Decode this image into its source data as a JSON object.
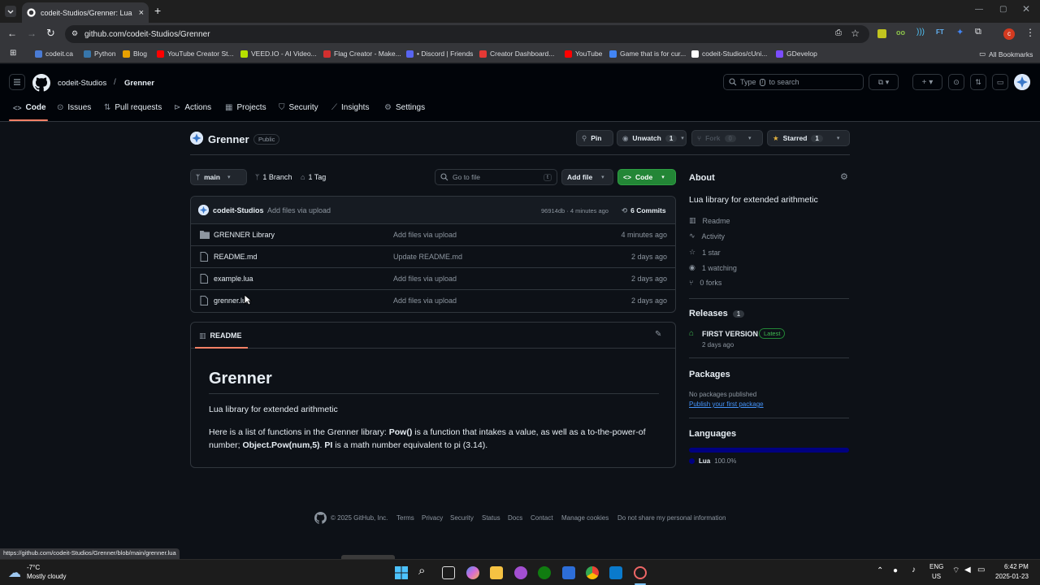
{
  "browser": {
    "tab_title": "codeit-Studios/Grenner: Lua lib…",
    "url": "github.com/codeit-Studios/Grenner",
    "bookmarks": [
      {
        "label": "codeit.ca",
        "color": "#4a7bd4"
      },
      {
        "label": "Python",
        "color": "#3776ab"
      },
      {
        "label": "Blog",
        "color": "#e8a100"
      },
      {
        "label": "YouTube Creator St...",
        "color": "#ff0000"
      },
      {
        "label": "VEED.IO - AI Video...",
        "color": "#b7e000"
      },
      {
        "label": "Flag Creator - Make...",
        "color": "#d32f2f"
      },
      {
        "label": "• Discord | Friends",
        "color": "#5865f2"
      },
      {
        "label": "Creator Dashboard...",
        "color": "#e53935"
      },
      {
        "label": "YouTube",
        "color": "#ff0000"
      },
      {
        "label": "Game that is for cur...",
        "color": "#4285f4"
      },
      {
        "label": "codeit-Studios/cUni...",
        "color": "#ffffff"
      },
      {
        "label": "GDevelop",
        "color": "#7b4dff"
      }
    ],
    "all_bookmarks": "All Bookmarks",
    "status_url": "https://github.com/codeit-Studios/Grenner/blob/main/grenner.lua"
  },
  "header": {
    "owner": "codeit-Studios",
    "slash": "/",
    "repo": "Grenner",
    "search_pre": "Type",
    "search_key": "/",
    "search_post": "to search"
  },
  "nav": {
    "code": "Code",
    "issues": "Issues",
    "pulls": "Pull requests",
    "actions": "Actions",
    "projects": "Projects",
    "security": "Security",
    "insights": "Insights",
    "settings": "Settings"
  },
  "repo": {
    "name": "Grenner",
    "visibility": "Public",
    "pin": "Pin",
    "unwatch": "Unwatch",
    "watch_count": "1",
    "fork": "Fork",
    "fork_count": "0",
    "starred": "Starred",
    "star_count": "1",
    "branch": "main",
    "branches": "1 Branch",
    "tags": "1 Tag",
    "goto_placeholder": "Go to file",
    "goto_key": "t",
    "add_file": "Add file",
    "code_btn": "Code"
  },
  "commit": {
    "author": "codeit-Studios",
    "message": "Add files via upload",
    "meta": "96914db · 4 minutes ago",
    "commits": "6 Commits"
  },
  "files": [
    {
      "name": "GRENNER Library",
      "message": "Add files via upload",
      "date": "4 minutes ago",
      "type": "folder"
    },
    {
      "name": "README.md",
      "message": "Update README.md",
      "date": "2 days ago",
      "type": "file"
    },
    {
      "name": "example.lua",
      "message": "Add files via upload",
      "date": "2 days ago",
      "type": "file"
    },
    {
      "name": "grenner.lua",
      "message": "Add files via upload",
      "date": "2 days ago",
      "type": "file"
    }
  ],
  "readme": {
    "tab": "README",
    "heading": "Grenner",
    "p1": "Lua library for extended arithmetic",
    "p2_a": "Here is a list of functions in the Grenner library: ",
    "p2_b": "Pow()",
    "p2_c": " is a function that intakes a value, as well as a to-the-power-of number; ",
    "p2_d": "Object.Pow(num,5)",
    "p2_e": ". ",
    "p2_f": "PI",
    "p2_g": " is a math number equivalent to pi (3.14)."
  },
  "about": {
    "title": "About",
    "description": "Lua library for extended arithmetic",
    "readme": "Readme",
    "activity": "Activity",
    "stars": "1 star",
    "watching": "1 watching",
    "forks": "0 forks"
  },
  "releases": {
    "title": "Releases",
    "count": "1",
    "name": "FIRST VERSION",
    "badge": "Latest",
    "date": "2 days ago"
  },
  "packages": {
    "title": "Packages",
    "none": "No packages published",
    "link": "Publish your first package"
  },
  "languages": {
    "title": "Languages",
    "name": "Lua",
    "percent": "100.0%",
    "color": "#000080"
  },
  "footer": {
    "copyright": "© 2025 GitHub, Inc.",
    "links": [
      "Terms",
      "Privacy",
      "Security",
      "Status",
      "Docs",
      "Contact",
      "Manage cookies",
      "Do not share my personal information"
    ]
  },
  "taskbar": {
    "temp": "-7°C",
    "weather": "Mostly cloudy",
    "lang1": "ENG",
    "lang2": "US",
    "time": "6:42 PM",
    "date": "2025-01-23"
  },
  "colors": {
    "accent": "#f78166",
    "green_btn": "#238636",
    "link": "#4493f8",
    "latest": "#3fb950"
  }
}
